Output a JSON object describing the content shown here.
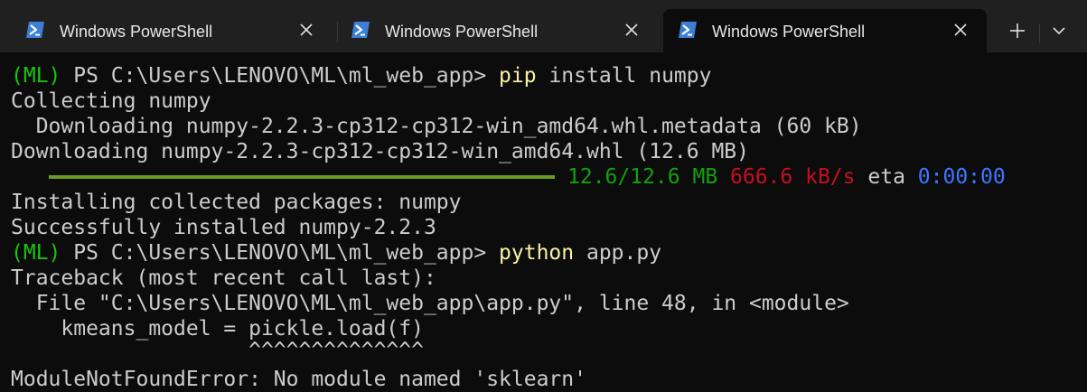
{
  "tabs": [
    {
      "title": "Windows PowerShell",
      "active": false
    },
    {
      "title": "Windows PowerShell",
      "active": false
    },
    {
      "title": "Windows PowerShell",
      "active": true
    }
  ],
  "icons": {
    "tab_icon": "powershell-icon",
    "close": "close-icon",
    "new_tab": "plus-icon",
    "dropdown": "chevron-down-icon"
  },
  "colors": {
    "env_prefix": "#16c60c",
    "command": "#f9f1a5",
    "progress": "#6a9a23",
    "size": "#13a10e",
    "speed": "#c50f1f",
    "eta": "#3b78ff"
  },
  "terminal": {
    "prompt1": {
      "env": "(ML)",
      "path": " PS C:\\Users\\LENOVO\\ML\\ml_web_app> ",
      "cmd": "pip",
      "args": " install numpy"
    },
    "line_collecting": "Collecting numpy",
    "line_downloading_meta": "  Downloading numpy-2.2.3-cp312-cp312-win_amd64.whl.metadata (60 kB)",
    "line_downloading_whl": "Downloading numpy-2.2.3-cp312-cp312-win_amd64.whl (12.6 MB)",
    "progress": {
      "fraction": 1.0,
      "size": "12.6/12.6 MB",
      "speed": "666.6 kB/s",
      "eta_label": "eta",
      "eta": "0:00:00"
    },
    "line_installing": "Installing collected packages: numpy",
    "line_success": "Successfully installed numpy-2.2.3",
    "prompt2": {
      "env": "(ML)",
      "path": " PS C:\\Users\\LENOVO\\ML\\ml_web_app> ",
      "cmd": "python",
      "args": " app.py"
    },
    "traceback": [
      "Traceback (most recent call last):",
      "  File \"C:\\Users\\LENOVO\\ML\\ml_web_app\\app.py\", line 48, in <module>",
      "    kmeans_model = pickle.load(f)",
      "                   ^^^^^^^^^^^^^^"
    ],
    "error": "ModuleNotFoundError: No module named 'sklearn'"
  }
}
